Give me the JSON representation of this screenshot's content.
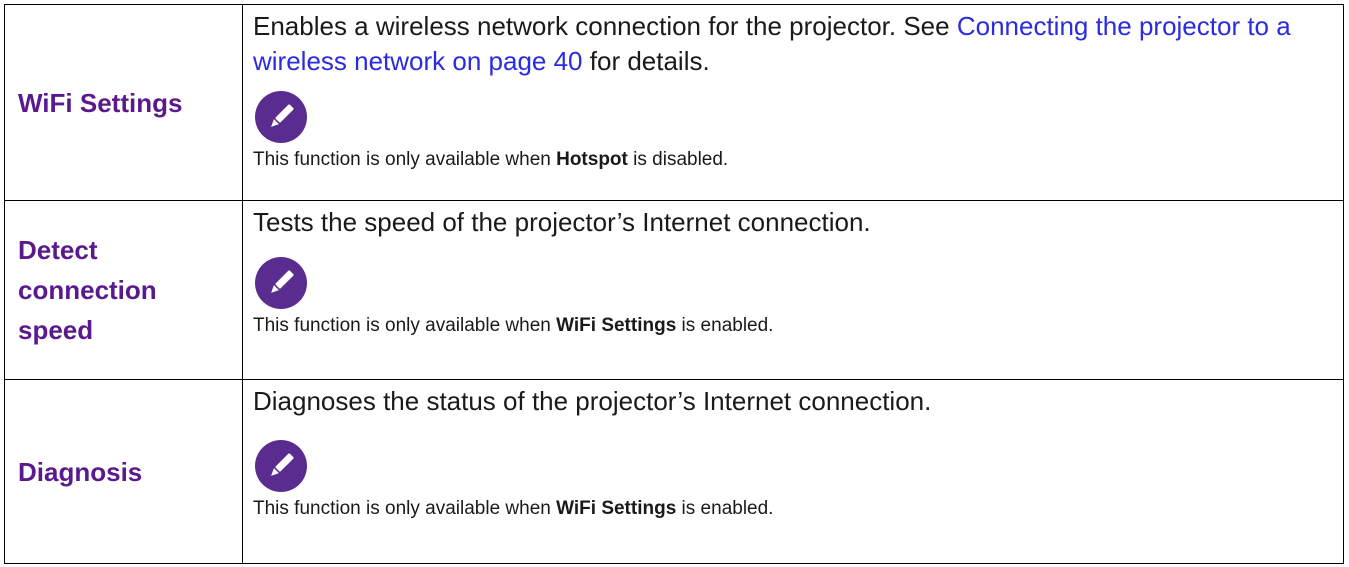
{
  "rows": [
    {
      "term": "WiFi Settings",
      "description_before_link": "Enables a wireless network connection for the projector. See ",
      "description_link": "Connecting the projector to a wireless network on page 40",
      "description_after_link": " for details.",
      "note_icon": "pencil-icon",
      "note_before": "This function is only available when ",
      "note_bold": "Hotspot",
      "note_after": " is disabled."
    },
    {
      "term": "Detect connection speed",
      "description": "Tests the speed of the projector’s Internet connection.",
      "note_icon": "pencil-icon",
      "note_before": "This function is only available when ",
      "note_bold": "WiFi Settings",
      "note_after": " is enabled."
    },
    {
      "term": "Diagnosis",
      "description": "Diagnoses the status of the projector’s Internet connection.",
      "note_icon": "pencil-icon",
      "note_before": "This function is only available when ",
      "note_bold": "WiFi Settings",
      "note_after": " is enabled."
    }
  ],
  "colors": {
    "term": "#5a1a8e",
    "link": "#2b2bdf",
    "note_icon_fill": "#5b2c8f",
    "border": "#000000"
  }
}
